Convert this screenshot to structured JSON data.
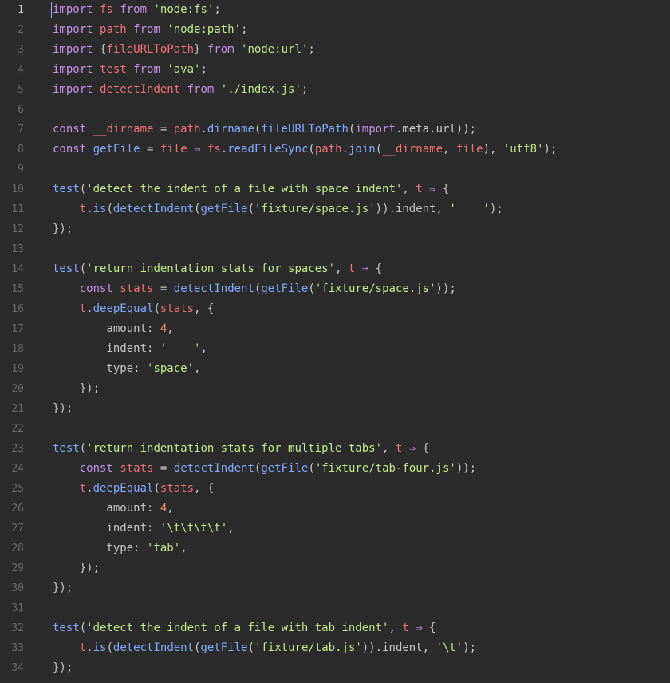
{
  "colors": {
    "background": "#2b2b2b",
    "gutter_text": "#6a6a6a",
    "gutter_active": "#cfcfcf",
    "plain": "#c8c8c8",
    "keyword": "#c792ea",
    "variable": "#f07178",
    "string": "#c3e88d",
    "function": "#82aaff",
    "number": "#f78c6c",
    "caret": "#8fb7ff"
  },
  "editor": {
    "active_line": 1,
    "lines": [
      {
        "n": "1",
        "tokens": [
          [
            "import",
            "keyword"
          ],
          [
            " ",
            "plain"
          ],
          [
            "fs",
            "variable"
          ],
          [
            " ",
            "plain"
          ],
          [
            "from",
            "keyword"
          ],
          [
            " ",
            "plain"
          ],
          [
            "'node:fs'",
            "string"
          ],
          [
            ";",
            "plain"
          ]
        ]
      },
      {
        "n": "2",
        "tokens": [
          [
            "import",
            "keyword"
          ],
          [
            " ",
            "plain"
          ],
          [
            "path",
            "variable"
          ],
          [
            " ",
            "plain"
          ],
          [
            "from",
            "keyword"
          ],
          [
            " ",
            "plain"
          ],
          [
            "'node:path'",
            "string"
          ],
          [
            ";",
            "plain"
          ]
        ]
      },
      {
        "n": "3",
        "tokens": [
          [
            "import",
            "keyword"
          ],
          [
            " {",
            "plain"
          ],
          [
            "fileURLToPath",
            "variable"
          ],
          [
            "} ",
            "plain"
          ],
          [
            "from",
            "keyword"
          ],
          [
            " ",
            "plain"
          ],
          [
            "'node:url'",
            "string"
          ],
          [
            ";",
            "plain"
          ]
        ]
      },
      {
        "n": "4",
        "tokens": [
          [
            "import",
            "keyword"
          ],
          [
            " ",
            "plain"
          ],
          [
            "test",
            "variable"
          ],
          [
            " ",
            "plain"
          ],
          [
            "from",
            "keyword"
          ],
          [
            " ",
            "plain"
          ],
          [
            "'ava'",
            "string"
          ],
          [
            ";",
            "plain"
          ]
        ]
      },
      {
        "n": "5",
        "tokens": [
          [
            "import",
            "keyword"
          ],
          [
            " ",
            "plain"
          ],
          [
            "detectIndent",
            "variable"
          ],
          [
            " ",
            "plain"
          ],
          [
            "from",
            "keyword"
          ],
          [
            " ",
            "plain"
          ],
          [
            "'./index.js'",
            "string"
          ],
          [
            ";",
            "plain"
          ]
        ]
      },
      {
        "n": "6",
        "tokens": []
      },
      {
        "n": "7",
        "tokens": [
          [
            "const",
            "keyword"
          ],
          [
            " ",
            "plain"
          ],
          [
            "__dirname",
            "variable"
          ],
          [
            " = ",
            "plain"
          ],
          [
            "path",
            "variable"
          ],
          [
            ".",
            "plain"
          ],
          [
            "dirname",
            "function"
          ],
          [
            "(",
            "plain"
          ],
          [
            "fileURLToPath",
            "function"
          ],
          [
            "(",
            "plain"
          ],
          [
            "import",
            "keyword"
          ],
          [
            ".meta.url));",
            "plain"
          ]
        ]
      },
      {
        "n": "8",
        "tokens": [
          [
            "const",
            "keyword"
          ],
          [
            " ",
            "plain"
          ],
          [
            "getFile",
            "function"
          ],
          [
            " = ",
            "plain"
          ],
          [
            "file",
            "variable"
          ],
          [
            " ",
            "plain"
          ],
          [
            "⇒",
            "keyword"
          ],
          [
            " ",
            "plain"
          ],
          [
            "fs",
            "variable"
          ],
          [
            ".",
            "plain"
          ],
          [
            "readFileSync",
            "function"
          ],
          [
            "(",
            "plain"
          ],
          [
            "path",
            "variable"
          ],
          [
            ".",
            "plain"
          ],
          [
            "join",
            "function"
          ],
          [
            "(",
            "plain"
          ],
          [
            "__dirname",
            "variable"
          ],
          [
            ", ",
            "plain"
          ],
          [
            "file",
            "variable"
          ],
          [
            "), ",
            "plain"
          ],
          [
            "'utf8'",
            "string"
          ],
          [
            ");",
            "plain"
          ]
        ]
      },
      {
        "n": "9",
        "tokens": []
      },
      {
        "n": "10",
        "tokens": [
          [
            "test",
            "function"
          ],
          [
            "(",
            "plain"
          ],
          [
            "'detect the indent of a file with space indent'",
            "string"
          ],
          [
            ", ",
            "plain"
          ],
          [
            "t",
            "variable"
          ],
          [
            " ",
            "plain"
          ],
          [
            "⇒",
            "keyword"
          ],
          [
            " {",
            "plain"
          ]
        ]
      },
      {
        "n": "11",
        "tokens": [
          [
            "    ",
            "plain"
          ],
          [
            "t",
            "variable"
          ],
          [
            ".",
            "plain"
          ],
          [
            "is",
            "function"
          ],
          [
            "(",
            "plain"
          ],
          [
            "detectIndent",
            "function"
          ],
          [
            "(",
            "plain"
          ],
          [
            "getFile",
            "function"
          ],
          [
            "(",
            "plain"
          ],
          [
            "'fixture/space.js'",
            "string"
          ],
          [
            ")).indent, ",
            "plain"
          ],
          [
            "'    '",
            "string"
          ],
          [
            ");",
            "plain"
          ]
        ]
      },
      {
        "n": "12",
        "tokens": [
          [
            "});",
            "plain"
          ]
        ]
      },
      {
        "n": "13",
        "tokens": []
      },
      {
        "n": "14",
        "tokens": [
          [
            "test",
            "function"
          ],
          [
            "(",
            "plain"
          ],
          [
            "'return indentation stats for spaces'",
            "string"
          ],
          [
            ", ",
            "plain"
          ],
          [
            "t",
            "variable"
          ],
          [
            " ",
            "plain"
          ],
          [
            "⇒",
            "keyword"
          ],
          [
            " {",
            "plain"
          ]
        ]
      },
      {
        "n": "15",
        "tokens": [
          [
            "    ",
            "plain"
          ],
          [
            "const",
            "keyword"
          ],
          [
            " ",
            "plain"
          ],
          [
            "stats",
            "variable"
          ],
          [
            " = ",
            "plain"
          ],
          [
            "detectIndent",
            "function"
          ],
          [
            "(",
            "plain"
          ],
          [
            "getFile",
            "function"
          ],
          [
            "(",
            "plain"
          ],
          [
            "'fixture/space.js'",
            "string"
          ],
          [
            "));",
            "plain"
          ]
        ]
      },
      {
        "n": "16",
        "tokens": [
          [
            "    ",
            "plain"
          ],
          [
            "t",
            "variable"
          ],
          [
            ".",
            "plain"
          ],
          [
            "deepEqual",
            "function"
          ],
          [
            "(",
            "plain"
          ],
          [
            "stats",
            "variable"
          ],
          [
            ", {",
            "plain"
          ]
        ]
      },
      {
        "n": "17",
        "tokens": [
          [
            "        amount: ",
            "plain"
          ],
          [
            "4",
            "number"
          ],
          [
            ",",
            "plain"
          ]
        ]
      },
      {
        "n": "18",
        "tokens": [
          [
            "        indent: ",
            "plain"
          ],
          [
            "'    '",
            "string"
          ],
          [
            ",",
            "plain"
          ]
        ]
      },
      {
        "n": "19",
        "tokens": [
          [
            "        type: ",
            "plain"
          ],
          [
            "'space'",
            "string"
          ],
          [
            ",",
            "plain"
          ]
        ]
      },
      {
        "n": "20",
        "tokens": [
          [
            "    });",
            "plain"
          ]
        ]
      },
      {
        "n": "21",
        "tokens": [
          [
            "});",
            "plain"
          ]
        ]
      },
      {
        "n": "22",
        "tokens": []
      },
      {
        "n": "23",
        "tokens": [
          [
            "test",
            "function"
          ],
          [
            "(",
            "plain"
          ],
          [
            "'return indentation stats for multiple tabs'",
            "string"
          ],
          [
            ", ",
            "plain"
          ],
          [
            "t",
            "variable"
          ],
          [
            " ",
            "plain"
          ],
          [
            "⇒",
            "keyword"
          ],
          [
            " {",
            "plain"
          ]
        ]
      },
      {
        "n": "24",
        "tokens": [
          [
            "    ",
            "plain"
          ],
          [
            "const",
            "keyword"
          ],
          [
            " ",
            "plain"
          ],
          [
            "stats",
            "variable"
          ],
          [
            " = ",
            "plain"
          ],
          [
            "detectIndent",
            "function"
          ],
          [
            "(",
            "plain"
          ],
          [
            "getFile",
            "function"
          ],
          [
            "(",
            "plain"
          ],
          [
            "'fixture/tab-four.js'",
            "string"
          ],
          [
            "));",
            "plain"
          ]
        ]
      },
      {
        "n": "25",
        "tokens": [
          [
            "    ",
            "plain"
          ],
          [
            "t",
            "variable"
          ],
          [
            ".",
            "plain"
          ],
          [
            "deepEqual",
            "function"
          ],
          [
            "(",
            "plain"
          ],
          [
            "stats",
            "variable"
          ],
          [
            ", {",
            "plain"
          ]
        ]
      },
      {
        "n": "26",
        "tokens": [
          [
            "        amount: ",
            "plain"
          ],
          [
            "4",
            "number"
          ],
          [
            ",",
            "plain"
          ]
        ]
      },
      {
        "n": "27",
        "tokens": [
          [
            "        indent: ",
            "plain"
          ],
          [
            "'\\t\\t\\t\\t'",
            "string"
          ],
          [
            ",",
            "plain"
          ]
        ]
      },
      {
        "n": "28",
        "tokens": [
          [
            "        type: ",
            "plain"
          ],
          [
            "'tab'",
            "string"
          ],
          [
            ",",
            "plain"
          ]
        ]
      },
      {
        "n": "29",
        "tokens": [
          [
            "    });",
            "plain"
          ]
        ]
      },
      {
        "n": "30",
        "tokens": [
          [
            "});",
            "plain"
          ]
        ]
      },
      {
        "n": "31",
        "tokens": []
      },
      {
        "n": "32",
        "tokens": [
          [
            "test",
            "function"
          ],
          [
            "(",
            "plain"
          ],
          [
            "'detect the indent of a file with tab indent'",
            "string"
          ],
          [
            ", ",
            "plain"
          ],
          [
            "t",
            "variable"
          ],
          [
            " ",
            "plain"
          ],
          [
            "⇒",
            "keyword"
          ],
          [
            " {",
            "plain"
          ]
        ]
      },
      {
        "n": "33",
        "tokens": [
          [
            "    ",
            "plain"
          ],
          [
            "t",
            "variable"
          ],
          [
            ".",
            "plain"
          ],
          [
            "is",
            "function"
          ],
          [
            "(",
            "plain"
          ],
          [
            "detectIndent",
            "function"
          ],
          [
            "(",
            "plain"
          ],
          [
            "getFile",
            "function"
          ],
          [
            "(",
            "plain"
          ],
          [
            "'fixture/tab.js'",
            "string"
          ],
          [
            ")).indent, ",
            "plain"
          ],
          [
            "'\\t'",
            "string"
          ],
          [
            ");",
            "plain"
          ]
        ]
      },
      {
        "n": "34",
        "tokens": [
          [
            "});",
            "plain"
          ]
        ]
      }
    ]
  }
}
